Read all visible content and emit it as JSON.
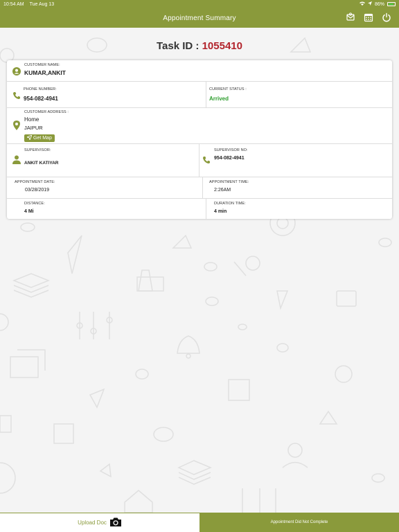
{
  "status_bar": {
    "time": "10:54 AM",
    "date": "Tue Aug 13",
    "battery": "86%"
  },
  "header": {
    "title": "Appointment Summary",
    "icons": [
      "chat-icon",
      "calendar-icon",
      "power-icon"
    ]
  },
  "task": {
    "label": "Task ID : ",
    "id": "1055410"
  },
  "customer": {
    "name_label": "CUSTOMER NAME:",
    "name": "KUMAR,ANKIT",
    "phone_label": "PHONE NUMBER:",
    "phone": "954-082-4941",
    "status_label": "CURRENT STATUS :",
    "status": "Arrived",
    "address_label": "CUSTOMER ADDRESS :",
    "address_line1": "Home",
    "address_line2": "JAIPUR",
    "get_map": "Get Map"
  },
  "supervisor": {
    "name_label": "SUPERVISOR:",
    "name": "ANKIT KATIYAR",
    "no_label": "SUPERVISOR NO:",
    "no": "954-082-4941"
  },
  "appointment": {
    "date_label": "APPOINTMENT DATE:",
    "date": "03/28/2019",
    "time_label": "APPOINTMENT TIME:",
    "time": "2:26AM",
    "distance_label": "DISTANCE:",
    "distance": "4 Mi",
    "duration_label": "DURATION TIME:",
    "duration": "4 min"
  },
  "footer": {
    "upload_label": "Upload Doc",
    "incomplete_label": "Appointment Did Not Complete"
  },
  "colors": {
    "accent": "#8a9a3b",
    "task_id": "#b2232b",
    "status_green": "#2e9e2e"
  }
}
